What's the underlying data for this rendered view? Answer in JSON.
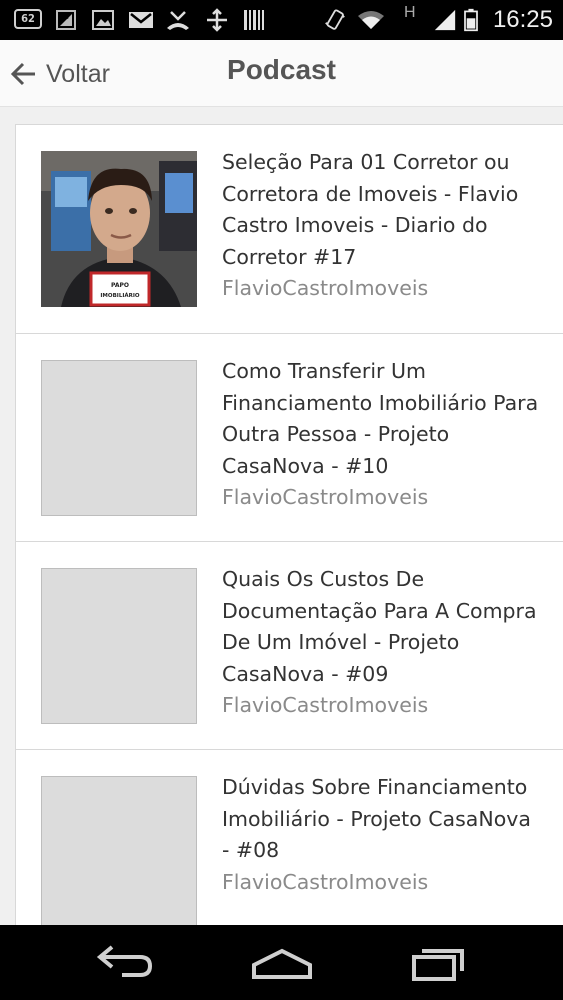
{
  "status_bar": {
    "badge": "62",
    "network": "3G",
    "signal_letter": "H",
    "time": "16:25"
  },
  "header": {
    "back_label": "Voltar",
    "title": "Podcast"
  },
  "episodes": [
    {
      "title": "Seleção Para 01 Corretor ou Corretora de Imoveis - Flavio Castro Imoveis - Diario do Corretor #17",
      "author": "FlavioCastroImoveis",
      "has_thumbnail": true,
      "thumbnail_caption": "PAPO IMOBILIÁRIO"
    },
    {
      "title": "Como Transferir Um Financiamento Imobiliário Para Outra Pessoa - Projeto CasaNova - #10",
      "author": "FlavioCastroImoveis",
      "has_thumbnail": false
    },
    {
      "title": "Quais Os Custos De Documentação Para A Compra De Um Imóvel - Projeto CasaNova - #09",
      "author": "FlavioCastroImoveis",
      "has_thumbnail": false
    },
    {
      "title": "Dúvidas Sobre Financiamento Imobiliário - Projeto CasaNova - #08",
      "author": "FlavioCastroImoveis",
      "has_thumbnail": false
    }
  ],
  "icons": {
    "back": "arrow-left-icon",
    "nav_back": "nav-back-icon",
    "nav_home": "nav-home-icon",
    "nav_recents": "nav-recents-icon"
  },
  "colors": {
    "status_bar": "#000000",
    "action_bar": "#fafafa",
    "title_text": "#555555",
    "author_text": "#8a8a8a",
    "placeholder": "#dcdcdc"
  }
}
